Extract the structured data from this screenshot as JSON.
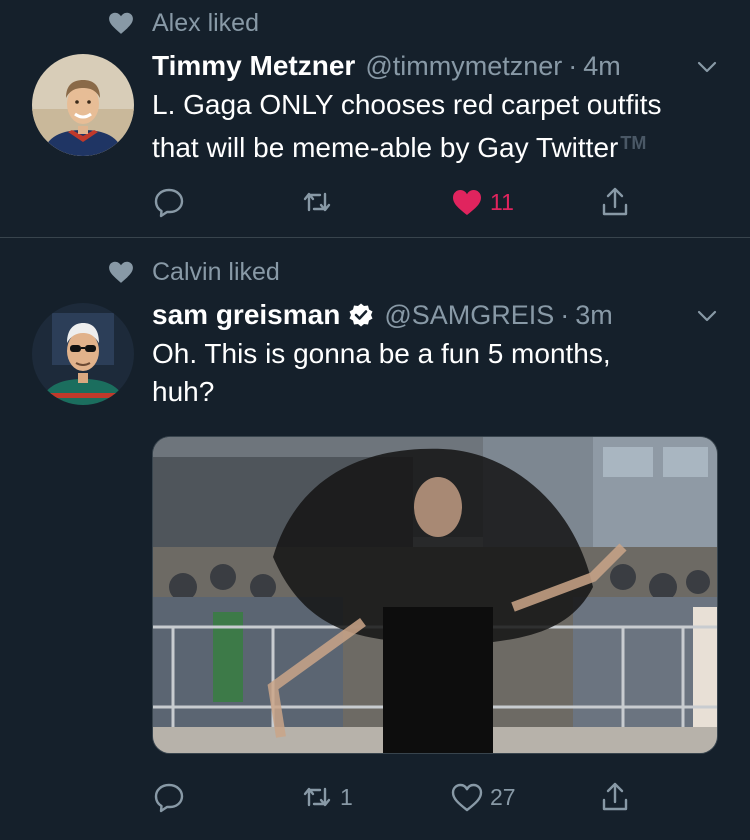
{
  "tweets": [
    {
      "liked_by": "Alex liked",
      "display_name": "Timmy Metzner",
      "handle": "@timmymetzner",
      "separator": "·",
      "time": "4m",
      "text_line1": "L. Gaga ONLY chooses red carpet outfits",
      "text_line2": "that will be meme-able by Gay Twitter",
      "trademark": "TM",
      "actions": {
        "reply_count": "",
        "retweet_count": "",
        "like_count": "11",
        "liked": true
      }
    },
    {
      "liked_by": "Calvin liked",
      "display_name": "sam greisman",
      "verified": true,
      "handle": "@SAMGREIS",
      "separator": "·",
      "time": "3m",
      "text_line1": "Oh. This is gonna be a fun 5 months,",
      "text_line2": "huh?",
      "has_media": true,
      "actions": {
        "reply_count": "",
        "retweet_count": "1",
        "like_count": "27",
        "liked": false
      }
    }
  ],
  "icons": {
    "liked_indicator": "heart-icon",
    "reply": "reply-icon",
    "retweet": "retweet-icon",
    "like": "heart-icon",
    "share": "share-icon",
    "menu": "chevron-down-icon",
    "verified": "verified-badge-icon"
  },
  "colors": {
    "background": "#15202b",
    "secondary_text": "#8899a6",
    "like_active": "#e0245e",
    "divider": "#38444d"
  }
}
